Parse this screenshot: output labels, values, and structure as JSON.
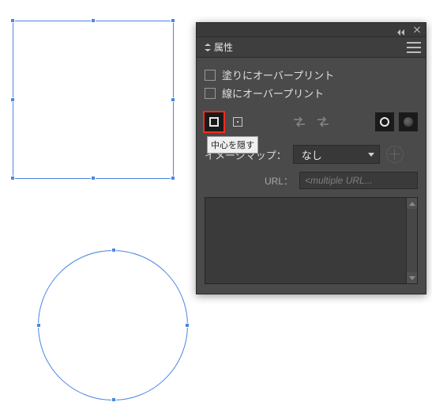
{
  "panel": {
    "tab_label": "属性",
    "overprint_fill_label": "塗りにオーバープリント",
    "overprint_stroke_label": "線にオーバープリント",
    "tooltip_hide_center": "中心を隠す",
    "imagemap_label": "イメージマップ：",
    "imagemap_value": "なし",
    "url_label": "URL：",
    "url_placeholder": "<multiple URL..."
  },
  "icons": {
    "close": "close",
    "collapse": "collapse",
    "flyout": "flyout-menu",
    "hide_center": "hide-center",
    "show_center": "show-center",
    "reverse_path": "reverse-path-off",
    "reverse_path2": "reverse-path-on",
    "nonzero": "nonzero-winding",
    "evenodd": "even-odd",
    "browser": "browser"
  }
}
